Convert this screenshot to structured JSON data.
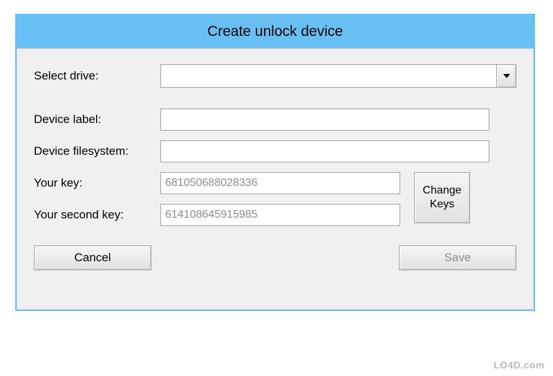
{
  "window": {
    "title": "Create unlock device"
  },
  "labels": {
    "select_drive": "Select drive:",
    "device_label": "Device label:",
    "device_fs": "Device filesystem:",
    "your_key": "Your key:",
    "your_second_key": "Your second key:"
  },
  "fields": {
    "drive_value": "",
    "device_label_value": "",
    "device_fs_value": "",
    "key1": "681050688028336",
    "key2": "614108645915985"
  },
  "buttons": {
    "change_keys": "Change Keys",
    "cancel": "Cancel",
    "save": "Save"
  },
  "states": {
    "save_disabled": true
  },
  "watermark": "LO4D.com"
}
